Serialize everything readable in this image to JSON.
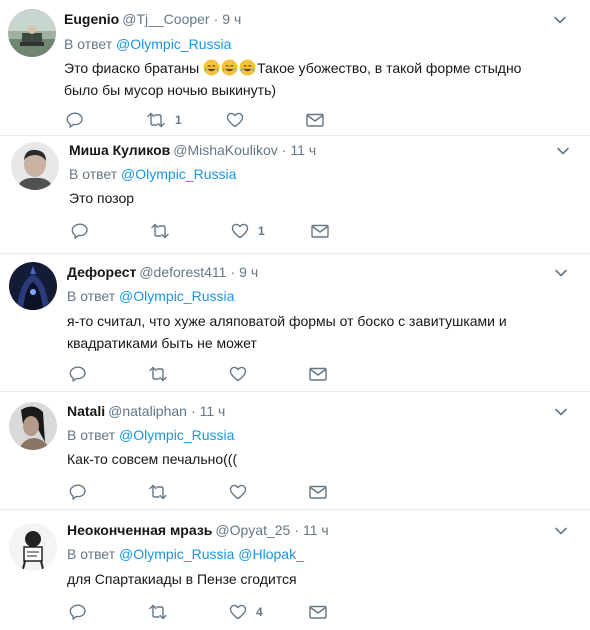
{
  "colors": {
    "link": "#1b95e0",
    "meta": "#657786",
    "text": "#14171a",
    "divider": "#e6ecf0"
  },
  "tweets": [
    {
      "name": "Eugenio",
      "handle": "@Tj__Cooper",
      "dot": "·",
      "time": "9 ч",
      "reply_prefix": "В ответ",
      "mentions": [
        "@Olympic_Russia"
      ],
      "text_before_emoji": "Это фиаско братаны ",
      "emoji": "face-with-tears-of-joy-icon",
      "emoji_count": 3,
      "text_after_emoji": "Такое убожество, в такой форме стыдно было бы мусор ночью выкинуть)",
      "counts": {
        "reply": "",
        "retweet": "1",
        "like": ""
      }
    },
    {
      "name": "Миша Куликов",
      "handle": "@MishaKoulikov",
      "dot": "·",
      "time": "11 ч",
      "reply_prefix": "В ответ",
      "mentions": [
        "@Olympic_Russia"
      ],
      "text": "Это позор",
      "counts": {
        "reply": "",
        "retweet": "",
        "like": "1"
      }
    },
    {
      "name": "Дефорест",
      "handle": "@deforest411",
      "dot": "·",
      "time": "9 ч",
      "reply_prefix": "В ответ",
      "mentions": [
        "@Olympic_Russia"
      ],
      "text": "я-то считал, что хуже аляповатой формы от боско с завитушками и квадратиками быть не может",
      "counts": {
        "reply": "",
        "retweet": "",
        "like": ""
      }
    },
    {
      "name": "Natali",
      "handle": "@nataliphan",
      "dot": "·",
      "time": "11 ч",
      "reply_prefix": "В ответ",
      "mentions": [
        "@Olympic_Russia"
      ],
      "text": "Как-то совсем печально(((",
      "counts": {
        "reply": "",
        "retweet": "",
        "like": ""
      }
    },
    {
      "name": "Неоконченная мразь",
      "handle": "@Opyat_25",
      "dot": "·",
      "time": "11 ч",
      "reply_prefix": "В ответ",
      "mentions": [
        "@Olympic_Russia",
        "@Hlopak_"
      ],
      "text": "для Спартакиады в Пензе сгодится",
      "counts": {
        "reply": "",
        "retweet": "",
        "like": "4"
      }
    }
  ]
}
